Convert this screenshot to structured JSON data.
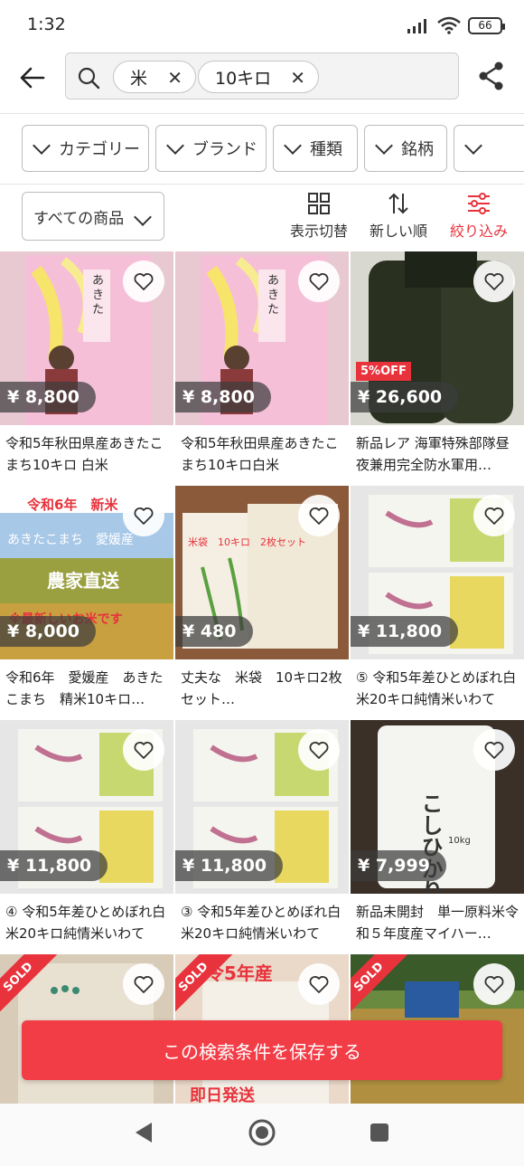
{
  "status_bar": {
    "time": "1:32",
    "battery": "66"
  },
  "search": {
    "chips": [
      {
        "label": "米",
        "remove": "✕"
      },
      {
        "label": "10キロ",
        "remove": "✕"
      }
    ]
  },
  "filters": [
    "カテゴリー",
    "ブランド",
    "種類",
    "銘柄",
    ""
  ],
  "sort_bar": {
    "all_products": "すべての商品",
    "view_toggle": "表示切替",
    "newest": "新しい順",
    "refine": "絞り込み"
  },
  "products": [
    {
      "price": "¥ 8,800",
      "title": "令和5年秋田県産あきたこまち10キロ 白米",
      "badge": "",
      "sold": ""
    },
    {
      "price": "¥ 8,800",
      "title": "令和5年秋田県産あきたこまち10キロ白米",
      "badge": "",
      "sold": ""
    },
    {
      "price": "¥ 26,600",
      "title": "新品レア 海軍特殊部隊昼夜兼用完全防水軍用…",
      "badge": "5%OFF",
      "sold": ""
    },
    {
      "price": "¥ 8,000",
      "title": "令和6年　愛媛産　あきたこまち　精米10キロ…",
      "badge": "",
      "sold": "",
      "image_text": [
        "令和6年　新米",
        "あきたこまち　愛媛産",
        "農家直送",
        "※最新しいお米です"
      ]
    },
    {
      "price": "¥ 480",
      "title": "丈夫な　米袋　10キロ2枚セット…",
      "badge": "",
      "sold": "",
      "image_text": [
        "米袋　10キロ　2枚セット"
      ]
    },
    {
      "price": "¥ 11,800",
      "title": "⑤ 令和5年差ひとめぼれ白米20キロ純情米いわて",
      "badge": "",
      "sold": ""
    },
    {
      "price": "¥ 11,800",
      "title": "④ 令和5年差ひとめぼれ白米20キロ純情米いわて",
      "badge": "",
      "sold": ""
    },
    {
      "price": "¥ 11,800",
      "title": "③ 令和5年差ひとめぼれ白米20キロ純情米いわて",
      "badge": "",
      "sold": ""
    },
    {
      "price": "¥ 7,999",
      "title": "新品未開封　単一原料米令和５年度産マイハー…",
      "badge": "",
      "sold": "",
      "image_text": [
        "こしひかり",
        "10kg"
      ]
    },
    {
      "price": "",
      "title": "",
      "badge": "",
      "sold": "SOLD"
    },
    {
      "price": "",
      "title": "",
      "badge": "",
      "sold": "SOLD",
      "image_text": [
        "令5年産",
        "即日発送"
      ]
    },
    {
      "price": "",
      "title": "",
      "badge": "",
      "sold": "SOLD"
    }
  ],
  "save_search": "この検索条件を保存する",
  "colors": {
    "accent": "#e8323c",
    "save_button": "#f23c46"
  }
}
